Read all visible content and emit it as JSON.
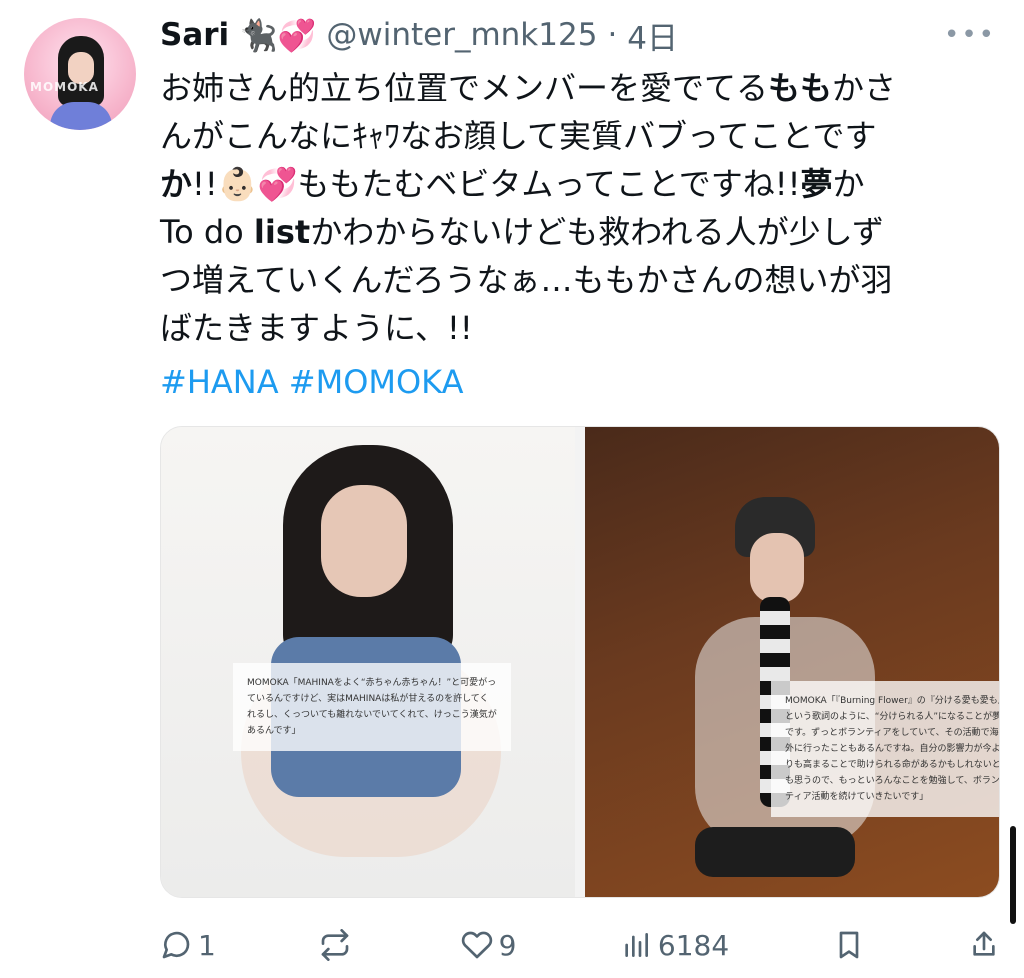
{
  "tweet": {
    "author": {
      "name": "Sari",
      "emoji": "🐈‍⬛💞",
      "handle": "@winter_mnk125",
      "separator": " · ",
      "time": "4日",
      "avatar_label": "MOMOKA"
    },
    "menu_icon": "more-icon",
    "text_lines": [
      [
        "お姉さん的立ち位置でメンバーを愛でてる",
        "もも",
        "かさ"
      ],
      [
        "んがこんなにｷｬﾜなお顔して実質バブってことです"
      ],
      [
        "か",
        "!!👶🏻💞ももたむベビタムってことですね!!",
        "夢",
        "か"
      ],
      [
        "To do ",
        "list",
        "かわからないけども救われる人が少しず"
      ],
      [
        "つ増えていくんだろうなぁ…ももかさんの想いが羽"
      ],
      [
        "ばたきますように、!!"
      ]
    ],
    "hashtags": [
      "#HANA",
      "#MOMOKA"
    ],
    "media": {
      "left_caption": "MOMOKA「MAHINAをよく“赤ちゃん赤ちゃん！”と可愛がっているんですけど、実はMAHINAは私が甘えるのを許してくれるし、くっついても離れないでいてくれて、けっこう漢気があるんです」",
      "right_caption": "MOMOKA「『Burning Flower』の『分ける愛も愛も』という歌詞のように、“分けられる人”になることが夢です。ずっとボランティアをしていて、その活動で海外に行ったこともあるんですね。自分の影響力が今よりも高まることで助けられる命があるかもしれないとも思うので、もっといろんなことを勉強して、ボランティア活動を続けていきたいです」"
    },
    "actions": {
      "reply": {
        "icon": "reply-icon",
        "count": "1"
      },
      "retweet": {
        "icon": "retweet-icon",
        "count": ""
      },
      "like": {
        "icon": "heart-icon",
        "count": "9"
      },
      "views": {
        "icon": "views-icon",
        "count": "6184"
      },
      "bookmark": {
        "icon": "bookmark-icon",
        "count": ""
      },
      "share": {
        "icon": "share-icon",
        "count": ""
      }
    }
  },
  "colors": {
    "text": "#0f1419",
    "secondary": "#536471",
    "link": "#1d9bf0",
    "background": "#ffffff"
  }
}
